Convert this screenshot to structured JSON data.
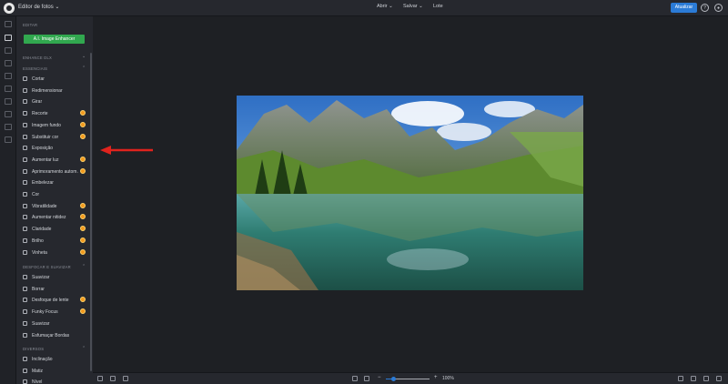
{
  "app": {
    "title": "Editor de fotos",
    "title_caret": "⌄"
  },
  "top_menu": [
    {
      "label": "Abrir ⌄"
    },
    {
      "label": "Salvar ⌄"
    },
    {
      "label": "Lote"
    }
  ],
  "top_right": {
    "update_label": "Atualizar",
    "help_glyph": "?",
    "account_glyph": "●"
  },
  "panel": {
    "edit_header": "EDITAR",
    "ai_button": "A.I. Image Enhancer",
    "enhance_header": "ENHANCE DLX",
    "essentials_header": "ESSENCIAIS",
    "blur_header": "DESFOCAR E SUAVIZAR",
    "misc_header": "DIVERSOS",
    "essentials": [
      {
        "label": "Cortar",
        "premium": false
      },
      {
        "label": "Redimensionar",
        "premium": false
      },
      {
        "label": "Girar",
        "premium": false
      },
      {
        "label": "Recorte",
        "premium": true
      },
      {
        "label": "Imagem fundo",
        "premium": true
      },
      {
        "label": "Substituir cor",
        "premium": true
      },
      {
        "label": "Exposição",
        "premium": false
      },
      {
        "label": "Aumentar luz",
        "premium": true
      },
      {
        "label": "Aprimoramento autom.",
        "premium": true
      },
      {
        "label": "Embelezar",
        "premium": false
      },
      {
        "label": "Cor",
        "premium": false
      },
      {
        "label": "Vibratilidade",
        "premium": true
      },
      {
        "label": "Aumentar nitidez",
        "premium": true
      },
      {
        "label": "Claridade",
        "premium": true
      },
      {
        "label": "Brilho",
        "premium": true
      },
      {
        "label": "Vinheta",
        "premium": true
      }
    ],
    "blur": [
      {
        "label": "Suavizar",
        "premium": false
      },
      {
        "label": "Borrar",
        "premium": false
      },
      {
        "label": "Desfoque de lente",
        "premium": true
      },
      {
        "label": "Funky Focus",
        "premium": true
      },
      {
        "label": "Suavizar",
        "premium": false
      },
      {
        "label": "Esfumaçar Bordas",
        "premium": false
      }
    ],
    "misc": [
      {
        "label": "Inclinação",
        "premium": false
      },
      {
        "label": "Matiz",
        "premium": false
      },
      {
        "label": "Nível",
        "premium": false
      }
    ]
  },
  "bottom": {
    "zoom_label": "100%",
    "zoom_minus": "−",
    "zoom_plus": "+",
    "zoom_fraction": 0.17
  },
  "colors": {
    "accent": "#2b7bd6",
    "ai_green": "#31a84f",
    "premium": "#f29a1f",
    "arrow": "#e0231d"
  }
}
